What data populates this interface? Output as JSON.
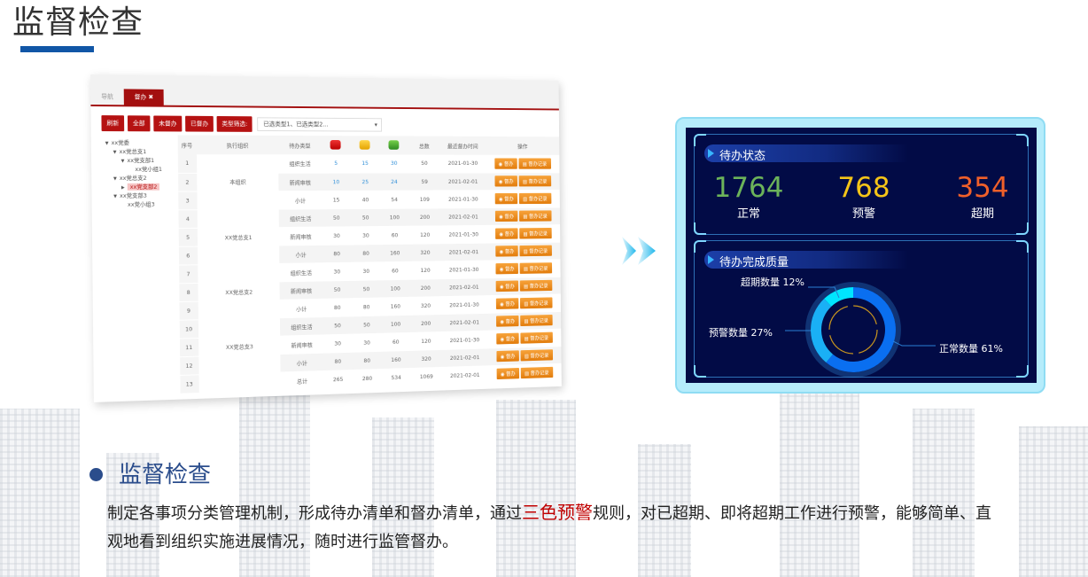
{
  "page": {
    "title": "监督检查",
    "accent_color": "#1156a6"
  },
  "screenshot": {
    "tabs": [
      {
        "label": "导航",
        "active": false
      },
      {
        "label": "督办 ✖",
        "active": true
      }
    ],
    "filter_buttons": [
      "刷新",
      "全部",
      "未督办",
      "已督办"
    ],
    "type_filter_label": "类型筛选:",
    "type_filter_value": "已选类型1、已选类型2...",
    "tree": [
      {
        "label": "xx党委",
        "level": 0,
        "toggle": "▼"
      },
      {
        "label": "xx党总支1",
        "level": 1,
        "toggle": "▼"
      },
      {
        "label": "xx党支部1",
        "level": 2,
        "toggle": "▼"
      },
      {
        "label": "xx党小组1",
        "level": 3,
        "toggle": ""
      },
      {
        "label": "xx党总支2",
        "level": 1,
        "toggle": "▼"
      },
      {
        "label": "xx党支部2",
        "level": 2,
        "toggle": "▶",
        "selected": true
      },
      {
        "label": "xx党支部3",
        "level": 1,
        "toggle": "▼"
      },
      {
        "label": "xx党小组3",
        "level": 2,
        "toggle": ""
      }
    ],
    "table": {
      "headers": {
        "seq": "序号",
        "org": "执行组织",
        "type": "待办类型",
        "red": "red-status-icon",
        "yellow": "yellow-status-icon",
        "green": "green-status-icon",
        "total": "总数",
        "last_time": "最近督办时间",
        "ops": "操作"
      },
      "ops": {
        "supervise": "◉ 督办",
        "record": "▤ 督办记录"
      },
      "groups": [
        {
          "org": "本组织",
          "rows": [
            {
              "seq": "1",
              "type": "组织生活",
              "red": "5",
              "yellow": "15",
              "green": "30",
              "total": "50",
              "time": "2021-01-30",
              "link": true
            },
            {
              "seq": "2",
              "type": "新闻审核",
              "red": "10",
              "yellow": "25",
              "green": "24",
              "total": "59",
              "time": "2021-02-01",
              "link": true
            },
            {
              "seq": "3",
              "type": "小计",
              "red": "15",
              "yellow": "40",
              "green": "54",
              "total": "109",
              "time": "2021-01-30"
            }
          ]
        },
        {
          "org": "XX党总支1",
          "rows": [
            {
              "seq": "4",
              "type": "组织生活",
              "red": "50",
              "yellow": "50",
              "green": "100",
              "total": "200",
              "time": "2021-02-01"
            },
            {
              "seq": "5",
              "type": "新闻审核",
              "red": "30",
              "yellow": "30",
              "green": "60",
              "total": "120",
              "time": "2021-01-30"
            },
            {
              "seq": "6",
              "type": "小计",
              "red": "80",
              "yellow": "80",
              "green": "160",
              "total": "320",
              "time": "2021-02-01"
            }
          ]
        },
        {
          "org": "XX党总支2",
          "rows": [
            {
              "seq": "7",
              "type": "组织生活",
              "red": "30",
              "yellow": "30",
              "green": "60",
              "total": "120",
              "time": "2021-01-30"
            },
            {
              "seq": "8",
              "type": "新闻审核",
              "red": "50",
              "yellow": "50",
              "green": "100",
              "total": "200",
              "time": "2021-02-01"
            },
            {
              "seq": "9",
              "type": "小计",
              "red": "80",
              "yellow": "80",
              "green": "160",
              "total": "320",
              "time": "2021-01-30"
            }
          ]
        },
        {
          "org": "XX党总支3",
          "rows": [
            {
              "seq": "10",
              "type": "组织生活",
              "red": "50",
              "yellow": "50",
              "green": "100",
              "total": "200",
              "time": "2021-02-01"
            },
            {
              "seq": "11",
              "type": "新闻审核",
              "red": "30",
              "yellow": "30",
              "green": "60",
              "total": "120",
              "time": "2021-01-30"
            },
            {
              "seq": "12",
              "type": "小计",
              "red": "80",
              "yellow": "80",
              "green": "160",
              "total": "320",
              "time": "2021-02-01"
            }
          ]
        },
        {
          "org": "",
          "rows": [
            {
              "seq": "13",
              "type": "总计",
              "red": "265",
              "yellow": "280",
              "green": "534",
              "total": "1069",
              "time": "2021-02-01"
            }
          ]
        }
      ]
    }
  },
  "dashboard": {
    "status_panel": {
      "title": "待办状态",
      "stats": [
        {
          "value": "1764",
          "label": "正常",
          "color": "#6cb35a"
        },
        {
          "value": "768",
          "label": "预警",
          "color": "#f5c518"
        },
        {
          "value": "354",
          "label": "超期",
          "color": "#f0602a"
        }
      ]
    },
    "quality_panel": {
      "title": "待办完成质量",
      "labels": {
        "overdue": "超期数量 12%",
        "warning": "预警数量 27%",
        "normal": "正常数量 61%"
      }
    }
  },
  "chart_data": {
    "type": "pie",
    "title": "待办完成质量",
    "donut": true,
    "slices": [
      {
        "name": "正常数量",
        "value": 61,
        "color": "#0a6ff0"
      },
      {
        "name": "预警数量",
        "value": 27,
        "color": "#1ab0f5"
      },
      {
        "name": "超期数量",
        "value": 12,
        "color": "#00e5ff"
      }
    ]
  },
  "section": {
    "title": "监督检查",
    "para_before": "制定各事项分类管理机制，形成待办清单和督办清单，通过",
    "para_highlight": "三色预警",
    "para_after": "规则，对已超期、即将超期工作进行预警，能够简单、直观地看到组织实施进展情况，随时进行监管督办。",
    "highlight_color": "#c00000"
  }
}
